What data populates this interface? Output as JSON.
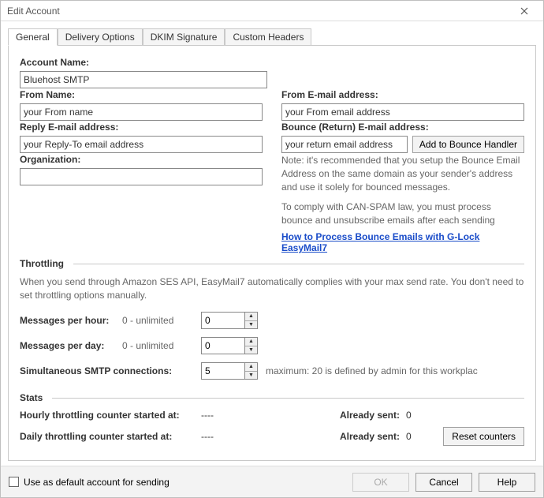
{
  "window": {
    "title": "Edit Account"
  },
  "tabs": {
    "general": "General",
    "delivery": "Delivery Options",
    "dkim": "DKIM Signature",
    "custom": "Custom Headers",
    "active": "general"
  },
  "fields": {
    "account_name": {
      "label": "Account Name:",
      "value": "Bluehost SMTP"
    },
    "from_name": {
      "label": "From Name:",
      "value": "your From name"
    },
    "from_email": {
      "label": "From E-mail address:",
      "value": "your From email address"
    },
    "reply_email": {
      "label": "Reply E-mail address:",
      "value": "your Reply-To email address"
    },
    "bounce_email": {
      "label": "Bounce (Return) E-mail address:",
      "value": "your return email address"
    },
    "organization": {
      "label": "Organization:",
      "value": ""
    }
  },
  "bounce": {
    "button": "Add to Bounce Handler",
    "note1": "Note: it's recommended that you setup the Bounce Email Address on the same domain as your sender's address and use it solely for bounced messages.",
    "note2": "To comply with CAN-SPAM law, you must process bounce and unsubscribe emails after each sending",
    "link": "How to Process Bounce Emails with G-Lock EasyMail7"
  },
  "throttling": {
    "title": "Throttling",
    "desc": "When you send through Amazon SES API, EasyMail7 automatically complies with your max send rate. You don't need to set throttling options manually.",
    "per_hour": {
      "label": "Messages per hour:",
      "hint": "0 - unlimited",
      "value": "0"
    },
    "per_day": {
      "label": "Messages per day:",
      "hint": "0 - unlimited",
      "value": "0"
    },
    "smtp_conn": {
      "label": "Simultaneous SMTP connections:",
      "value": "5",
      "after": "maximum: 20 is defined by admin for this workplac"
    }
  },
  "stats": {
    "title": "Stats",
    "hourly": {
      "label": "Hourly throttling counter started at:",
      "value": "----",
      "sent_label": "Already sent:",
      "sent_value": "0"
    },
    "daily": {
      "label": "Daily throttling counter started at:",
      "value": "----",
      "sent_label": "Already sent:",
      "sent_value": "0"
    },
    "reset": "Reset counters"
  },
  "footer": {
    "default_checkbox": "Use as default account for sending",
    "ok": "OK",
    "cancel": "Cancel",
    "help": "Help"
  }
}
